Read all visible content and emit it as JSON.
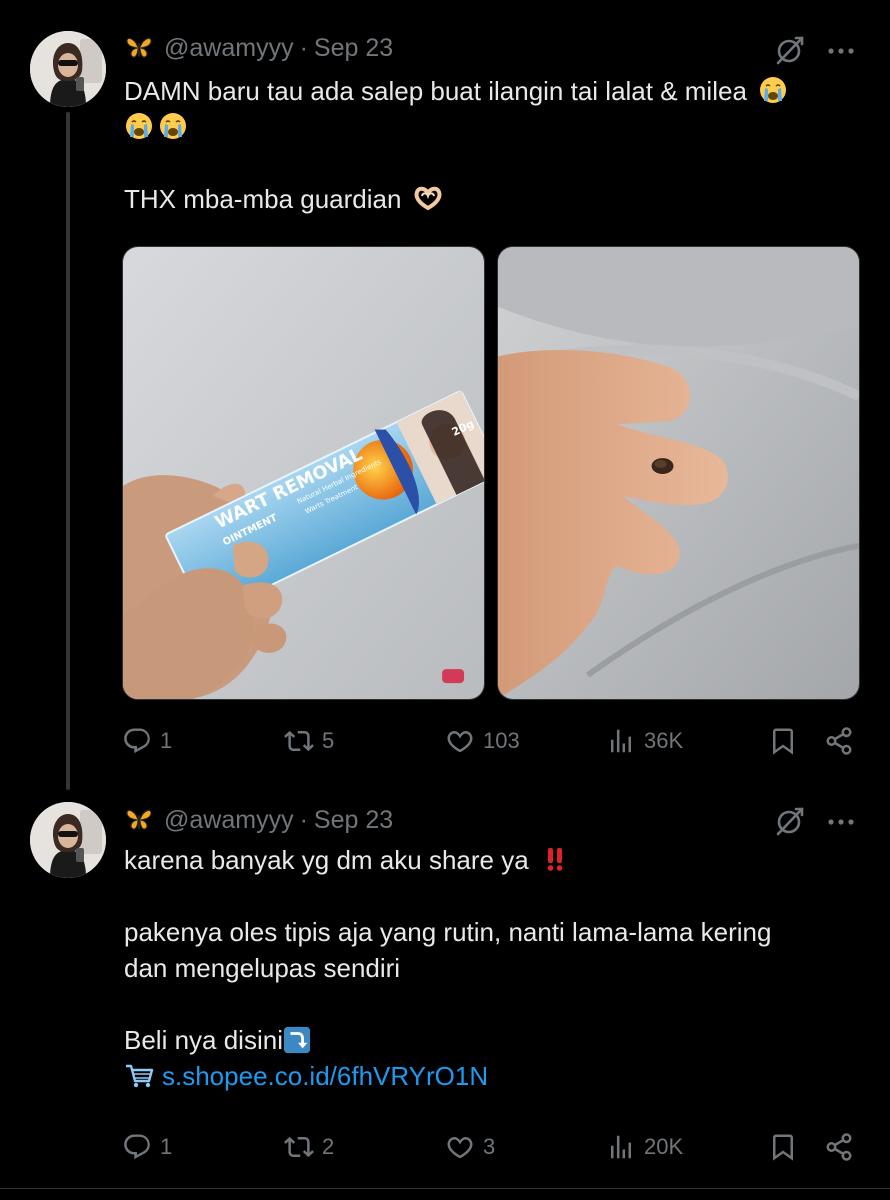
{
  "tweets": [
    {
      "handle": "@awamyyy",
      "separator": "·",
      "date": "Sep 23",
      "text_lines": [
        "DAMN baru tau ada salep buat ilangin tai lalat & milea",
        "",
        "THX mba-mba guardian"
      ],
      "media": {
        "product_name": "WART REMOVAL",
        "product_type": "OINTMENT",
        "product_subtitle": "Natural Herbal Ingredients",
        "product_subtitle2": "Warts Treatment",
        "weight": "20g"
      },
      "stats": {
        "replies": "1",
        "reposts": "5",
        "likes": "103",
        "views": "36K"
      }
    },
    {
      "handle": "@awamyyy",
      "separator": "·",
      "date": "Sep 23",
      "text_lines": [
        "karena banyak yg dm aku share ya",
        "",
        "pakenya oles tipis aja yang rutin, nanti lama-lama kering",
        "dan mengelupas sendiri",
        "",
        "Beli nya disini"
      ],
      "link": "s.shopee.co.id/6fhVRYrO1N",
      "stats": {
        "replies": "1",
        "reposts": "2",
        "likes": "3",
        "views": "20K"
      }
    }
  ],
  "colors": {
    "background": "#000000",
    "text": "#e7e9ea",
    "muted": "#71767b",
    "link": "#1d9bf0",
    "rule": "#2f3336"
  },
  "icons": [
    "butterfly-icon",
    "grok-icon",
    "more-icon",
    "reply-icon",
    "repost-icon",
    "like-icon",
    "views-icon",
    "bookmark-icon",
    "share-icon",
    "crying-emoji",
    "heart-hands-emoji",
    "double-exclamation-emoji",
    "arrow-down-emoji",
    "cart-emoji"
  ]
}
